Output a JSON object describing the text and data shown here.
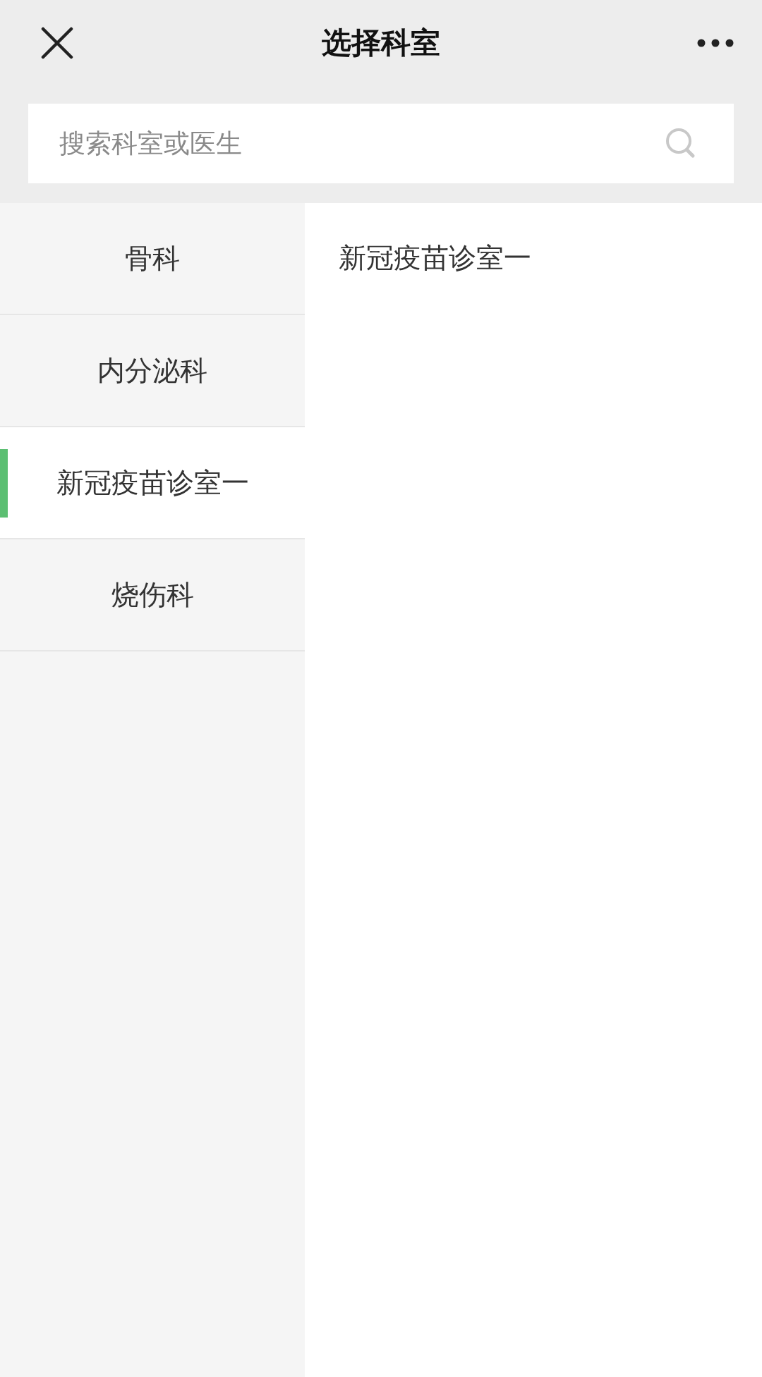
{
  "header": {
    "title": "选择科室"
  },
  "search": {
    "placeholder": "搜索科室或医生"
  },
  "departments": [
    {
      "label": "骨科",
      "selected": false
    },
    {
      "label": "内分泌科",
      "selected": false
    },
    {
      "label": "新冠疫苗诊室一",
      "selected": true
    },
    {
      "label": "烧伤科",
      "selected": false
    }
  ],
  "rooms": [
    {
      "label": "新冠疫苗诊室一"
    }
  ]
}
